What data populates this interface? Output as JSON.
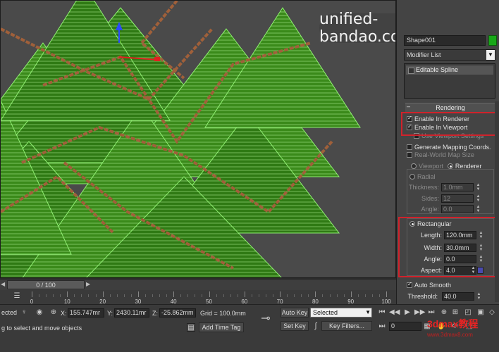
{
  "watermark": {
    "text": "unified-bandao.com.cn"
  },
  "command_panel": {
    "object_name": "Shape001",
    "object_color": "#18a818",
    "modifier_list_label": "Modifier List",
    "stack_items": [
      "Editable Spline"
    ],
    "rollout_title": "Rendering",
    "enable_in_renderer": {
      "label": "Enable In Renderer",
      "checked": true
    },
    "enable_in_viewport": {
      "label": "Enable In Viewport",
      "checked": true
    },
    "use_viewport_settings": {
      "label": "Use Viewport Settings",
      "checked": false
    },
    "generate_mapping": {
      "label": "Generate Mapping Coords.",
      "checked": false
    },
    "real_world_map": {
      "label": "Real-World Map Size",
      "checked": false
    },
    "viewport_radio": "Viewport",
    "renderer_radio": "Renderer",
    "radial": {
      "label": "Radial",
      "thickness_label": "Thickness:",
      "thickness": "1.0mm",
      "sides_label": "Sides:",
      "sides": "12",
      "angle_label": "Angle:",
      "angle": "0.0"
    },
    "rectangular": {
      "label": "Rectangular",
      "length_label": "Length:",
      "length": "120.0mm",
      "width_label": "Width:",
      "width": "30.0mm",
      "angle_label": "Angle:",
      "angle": "0.0",
      "aspect_label": "Aspect:",
      "aspect": "4.0"
    },
    "auto_smooth": {
      "label": "Auto Smooth",
      "checked": true
    },
    "threshold_label": "Threshold:",
    "threshold": "40.0",
    "highlight_color": "#d0222b"
  },
  "time_slider": {
    "label": "0 / 100"
  },
  "trackbar": {
    "ticks": [
      "0",
      "10",
      "20",
      "30",
      "40",
      "50",
      "60",
      "70",
      "80",
      "90",
      "100"
    ]
  },
  "status_bar": {
    "selection_text": "ected",
    "prompt_text": "g to select and move objects",
    "x_label": "X:",
    "x_value": "155.747mr",
    "y_label": "Y:",
    "y_value": "2430.11mr",
    "z_label": "Z:",
    "z_value": "-25.862mm",
    "grid_text": "Grid = 100.0mm",
    "add_time_tag": "Add Time Tag",
    "auto_key": "Auto Key",
    "set_key": "Set Key",
    "selected_dropdown": "Selected",
    "key_filters": "Key Filters...",
    "frame_value": "0"
  },
  "logo": {
    "text": "3dmax教程",
    "sub": "www.3dmax8.com"
  }
}
